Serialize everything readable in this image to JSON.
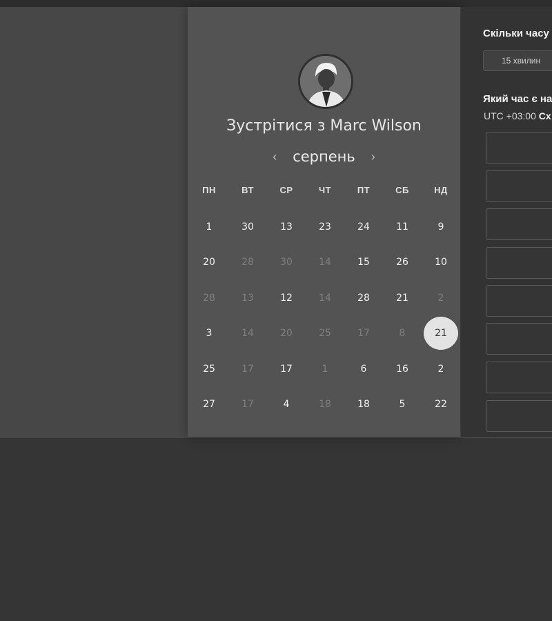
{
  "host": {
    "name": "Marc Wilson",
    "title_prefix": "Зустрітися з",
    "title": "Зустрітися з Marc Wilson"
  },
  "calendar": {
    "month": "серпень",
    "prev_icon": "chevron-left-icon",
    "next_icon": "chevron-right-icon",
    "weekdays": [
      "ПН",
      "ВТ",
      "СР",
      "ЧТ",
      "ПТ",
      "СБ",
      "НД"
    ],
    "weeks": [
      [
        {
          "d": "1",
          "m": false
        },
        {
          "d": "30",
          "m": false
        },
        {
          "d": "13",
          "m": false
        },
        {
          "d": "23",
          "m": false
        },
        {
          "d": "24",
          "m": false
        },
        {
          "d": "11",
          "m": false
        },
        {
          "d": "9",
          "m": false
        }
      ],
      [
        {
          "d": "20",
          "m": false
        },
        {
          "d": "28",
          "m": true
        },
        {
          "d": "30",
          "m": true
        },
        {
          "d": "14",
          "m": true
        },
        {
          "d": "15",
          "m": false
        },
        {
          "d": "26",
          "m": false
        },
        {
          "d": "10",
          "m": false
        }
      ],
      [
        {
          "d": "28",
          "m": true
        },
        {
          "d": "13",
          "m": true
        },
        {
          "d": "12",
          "m": false
        },
        {
          "d": "14",
          "m": true
        },
        {
          "d": "28",
          "m": false
        },
        {
          "d": "21",
          "m": false
        },
        {
          "d": "2",
          "m": true
        }
      ],
      [
        {
          "d": "3",
          "m": false
        },
        {
          "d": "14",
          "m": true
        },
        {
          "d": "20",
          "m": true
        },
        {
          "d": "25",
          "m": true
        },
        {
          "d": "17",
          "m": true
        },
        {
          "d": "8",
          "m": true
        },
        {
          "d": "21",
          "m": false,
          "selected": true
        }
      ],
      [
        {
          "d": "25",
          "m": false
        },
        {
          "d": "17",
          "m": true
        },
        {
          "d": "17",
          "m": false
        },
        {
          "d": "1",
          "m": true
        },
        {
          "d": "6",
          "m": false
        },
        {
          "d": "16",
          "m": false
        },
        {
          "d": "2",
          "m": false
        }
      ],
      [
        {
          "d": "27",
          "m": false
        },
        {
          "d": "17",
          "m": true
        },
        {
          "d": "4",
          "m": false
        },
        {
          "d": "18",
          "m": true
        },
        {
          "d": "18",
          "m": false
        },
        {
          "d": "5",
          "m": false
        },
        {
          "d": "22",
          "m": false
        }
      ]
    ]
  },
  "scheduler": {
    "duration_title": "Скільки часу",
    "duration_value": "15 хвилин",
    "time_title": "Який час є на",
    "timezone_offset": "UTC +03:00",
    "timezone_name": "Сх",
    "slots": [
      "",
      "",
      "",
      "",
      "",
      "",
      "",
      ""
    ]
  },
  "colors": {
    "selected_day_bg": "#e3e3e3",
    "card_bg": "#535353",
    "panel_bg": "#333333"
  }
}
